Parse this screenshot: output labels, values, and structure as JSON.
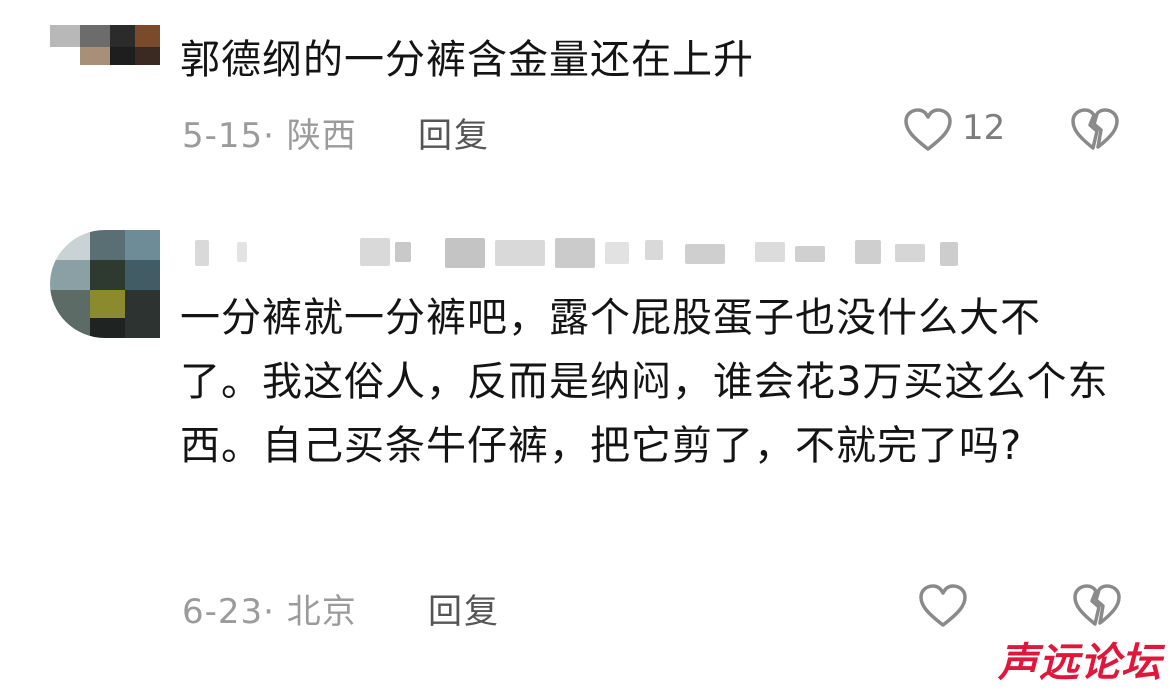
{
  "comments": [
    {
      "text": "郭德纲的一分裤含金量还在上升",
      "date_location": "5-15· 陕西",
      "reply_label": "回复",
      "like_count": "12"
    },
    {
      "text": "一分裤就一分裤吧，露个屁股蛋子也没什么大不了。我这俗人，反而是纳闷，谁会花3万买这么个东西。自己买条牛仔裤，把它剪了，不就完了吗?",
      "date_location": "6-23· 北京",
      "reply_label": "回复",
      "like_count": ""
    }
  ],
  "watermark": "声远论坛",
  "colors": {
    "text": "#141414",
    "meta": "#9b9b9b",
    "icon": "#8a8a8a",
    "watermark": "#e0173b"
  },
  "icons": [
    "heart-outline-icon",
    "broken-heart-icon"
  ]
}
